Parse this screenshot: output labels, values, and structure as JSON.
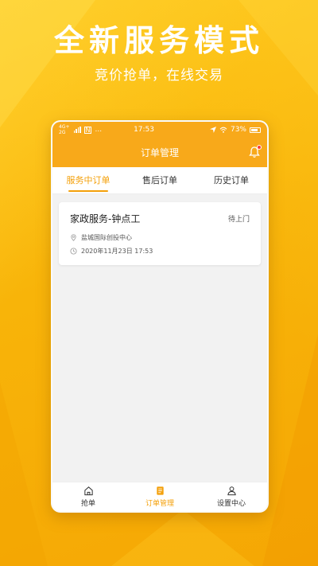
{
  "promo": {
    "title": "全新服务模式",
    "subtitle": "竞价抢单，在线交易"
  },
  "status_bar": {
    "network_top": "4G+",
    "network_bottom": "2G",
    "extra": "...",
    "time": "17:53",
    "battery": "73%"
  },
  "app_bar": {
    "title": "订单管理"
  },
  "tabs": [
    {
      "label": "服务中订单",
      "active": true
    },
    {
      "label": "售后订单",
      "active": false
    },
    {
      "label": "历史订单",
      "active": false
    }
  ],
  "order": {
    "title": "家政服务-钟点工",
    "status": "待上门",
    "address": "盐城国际创投中心",
    "datetime": "2020年11月23日 17:53"
  },
  "bottom_nav": [
    {
      "label": "抢单",
      "icon": "home-icon",
      "active": false
    },
    {
      "label": "订单管理",
      "icon": "order-list-icon",
      "active": true
    },
    {
      "label": "设置中心",
      "icon": "user-icon",
      "active": false
    }
  ],
  "colors": {
    "accent": "#f4a00a",
    "header": "#f8a91a",
    "background": "#f9b50a"
  }
}
